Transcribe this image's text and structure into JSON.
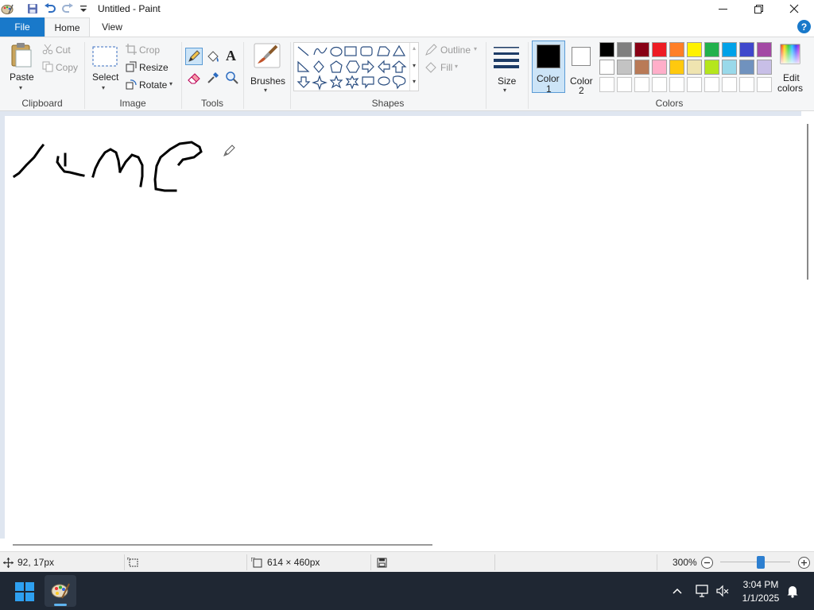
{
  "window": {
    "title": "Untitled - Paint",
    "quick_access": [
      "paint-app-icon",
      "save-icon",
      "undo-icon",
      "redo-icon",
      "customize-quick-access-icon"
    ]
  },
  "tabs": [
    {
      "label": "File",
      "active": false
    },
    {
      "label": "Home",
      "active": true
    },
    {
      "label": "View",
      "active": false
    }
  ],
  "ribbon": {
    "clipboard": {
      "group_label": "Clipboard",
      "paste_label": "Paste",
      "cut_label": "Cut",
      "copy_label": "Copy"
    },
    "image": {
      "group_label": "Image",
      "select_label": "Select",
      "crop_label": "Crop",
      "resize_label": "Resize",
      "rotate_label": "Rotate"
    },
    "tools": {
      "group_label": "Tools",
      "items": [
        "pencil-icon",
        "fill-bucket-icon",
        "text-icon",
        "eraser-icon",
        "color-picker-icon",
        "magnifier-icon"
      ],
      "text_glyph": "A"
    },
    "brushes": {
      "label": "Brushes"
    },
    "shapes": {
      "group_label": "Shapes",
      "outline_label": "Outline",
      "fill_label": "Fill"
    },
    "size": {
      "label": "Size"
    },
    "colors": {
      "group_label": "Colors",
      "color1_label": "Color",
      "color1_num": "1",
      "color2_label": "Color",
      "color2_num": "2",
      "color1_value": "#000000",
      "color2_value": "#ffffff",
      "edit_label_1": "Edit",
      "edit_label_2": "colors",
      "palette_row1": [
        "#000000",
        "#7f7f7f",
        "#880015",
        "#ed1c24",
        "#ff7f27",
        "#fff200",
        "#22b14c",
        "#00a2e8",
        "#3f48cc",
        "#a349a4"
      ],
      "palette_row2": [
        "#ffffff",
        "#c3c3c3",
        "#b97a57",
        "#ffaec9",
        "#ffc90e",
        "#efe4b0",
        "#b5e61d",
        "#99d9ea",
        "#7092be",
        "#c8bfe7"
      ]
    },
    "help_glyph": "?"
  },
  "status": {
    "cursor_pos": "92, 17px",
    "image_size": "614 × 460px",
    "zoom": "300%",
    "zoom_slider_fraction": 0.58
  },
  "taskbar": {
    "time": "3:04 PM",
    "date": "1/1/2025"
  }
}
